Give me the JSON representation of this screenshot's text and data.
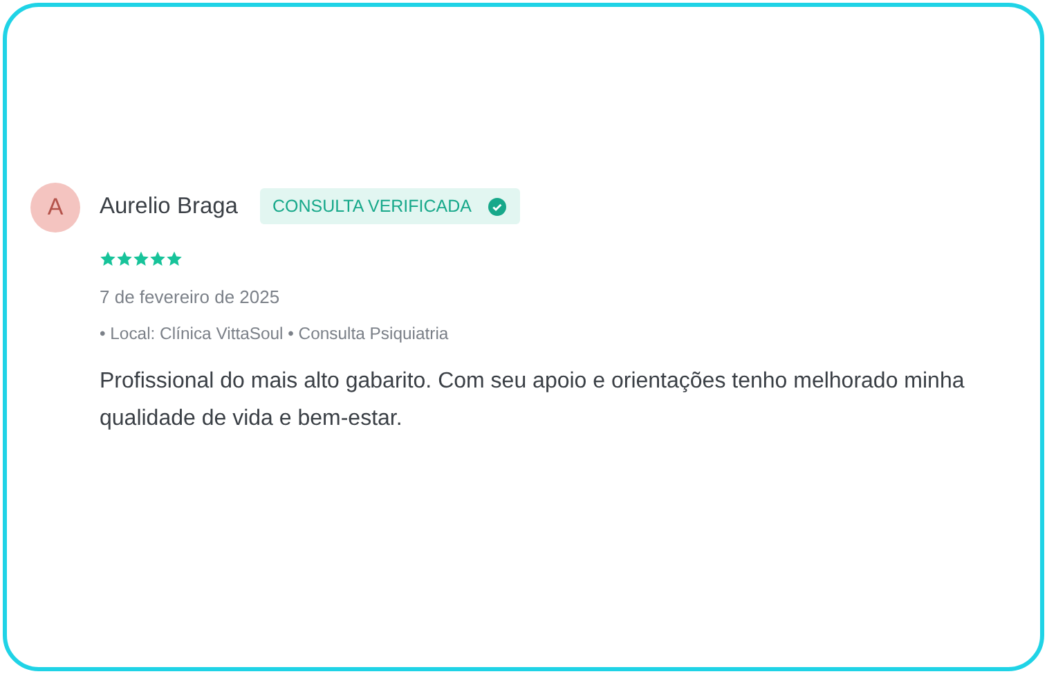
{
  "review": {
    "avatar_initial": "A",
    "author": "Aurelio Braga",
    "badge": "CONSULTA VERIFICADA",
    "stars": 5,
    "date": "7 de fevereiro de 2025",
    "details": "• Local: Clínica VittaSoul • Consulta Psiquiatria",
    "text": "Profissional do mais alto gabarito. Com seu apoio e orientações tenho melhorado minha qualidade de vida e bem-estar."
  }
}
